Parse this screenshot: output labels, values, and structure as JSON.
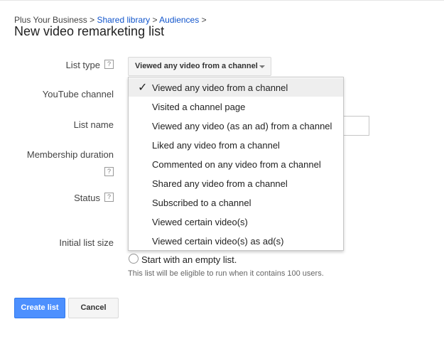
{
  "breadcrumb": {
    "root": "Plus Your Business",
    "sep1": ">",
    "item1": "Shared library",
    "sep2": ">",
    "item2": "Audiences",
    "sep3": ">"
  },
  "page_title": "New video remarketing list",
  "form": {
    "list_type_label": "List type",
    "youtube_channel_label": "YouTube channel",
    "list_name_label": "List name",
    "membership_duration_label": "Membership duration",
    "status_label": "Status",
    "initial_list_size_label": "Initial list size",
    "help_glyph": "?"
  },
  "list_type_select": {
    "selected": "Viewed any video from a channel",
    "options": [
      "Viewed any video from a channel",
      "Visited a channel page",
      "Viewed any video (as an ad) from a channel",
      "Liked any video from a channel",
      "Commented on any video from a channel",
      "Shared any video from a channel",
      "Subscribed to a channel",
      "Viewed certain video(s)",
      "Viewed certain video(s) as ad(s)"
    ],
    "check_glyph": "✓"
  },
  "initial_size": {
    "radio_label": "Start with an empty list.",
    "note": "This list will be eligible to run when it contains 100 users."
  },
  "buttons": {
    "create": "Create list",
    "cancel": "Cancel"
  },
  "colors": {
    "link": "#1155cc",
    "primary_button": "#4d90fe",
    "selected_item_bg": "#eeeeee"
  }
}
